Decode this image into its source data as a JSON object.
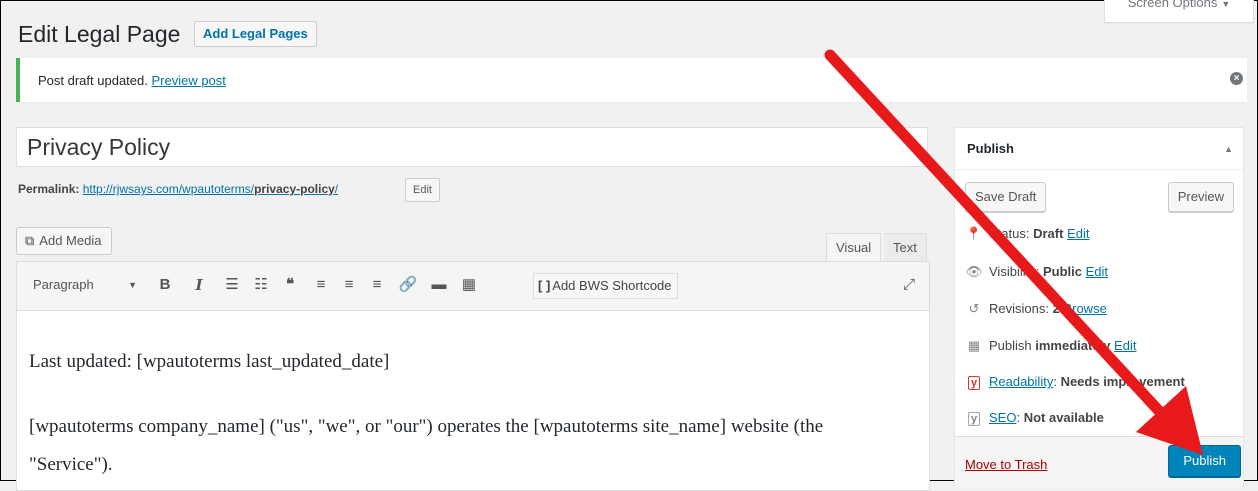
{
  "screen_options": {
    "label": "Screen Options"
  },
  "header": {
    "title": "Edit Legal Page",
    "add_button": "Add Legal Pages"
  },
  "notice": {
    "text": "Post draft updated.",
    "link": "Preview post"
  },
  "post": {
    "title": "Privacy Policy",
    "permalink_label": "Permalink:",
    "permalink_base": "http://rjwsays.com/wpautoterms/",
    "permalink_slug": "privacy-policy",
    "permalink_trailing": "/",
    "permalink_edit": "Edit"
  },
  "editor": {
    "add_media": "Add Media",
    "tab_visual": "Visual",
    "tab_text": "Text",
    "format_select": "Paragraph",
    "toolbar_icons": [
      "bold-icon",
      "italic-icon",
      "bullet-list-icon",
      "numbered-list-icon",
      "blockquote-icon",
      "align-left-icon",
      "align-center-icon",
      "align-right-icon",
      "link-icon",
      "read-more-icon",
      "toolbar-toggle-icon"
    ],
    "bws_button": "Add BWS Shortcode",
    "content": {
      "p1": "Last updated: [wpautoterms last_updated_date]",
      "p2": "[wpautoterms company_name] (\"us\", \"we\", or \"our\") operates the [wpautoterms site_name] website (the \"Service\")."
    }
  },
  "publish": {
    "title": "Publish",
    "save_draft": "Save Draft",
    "preview": "Preview",
    "status_label": "Status:",
    "status_value": "Draft",
    "visibility_label": "Visibility:",
    "visibility_value": "Public",
    "revisions_label": "Revisions:",
    "revisions_value": "2",
    "schedule_label": "Publish",
    "schedule_value": "immediately",
    "readability_label": "Readability",
    "readability_value": "Needs improvement",
    "seo_label": "SEO",
    "seo_value": "Not available",
    "edit": "Edit",
    "browse": "Browse",
    "trash": "Move to Trash",
    "publish_button": "Publish"
  },
  "colors": {
    "accent": "#0073aa",
    "publish": "#0085ba",
    "notice_success": "#46b450",
    "annotation_arrow": "#e8191b"
  }
}
